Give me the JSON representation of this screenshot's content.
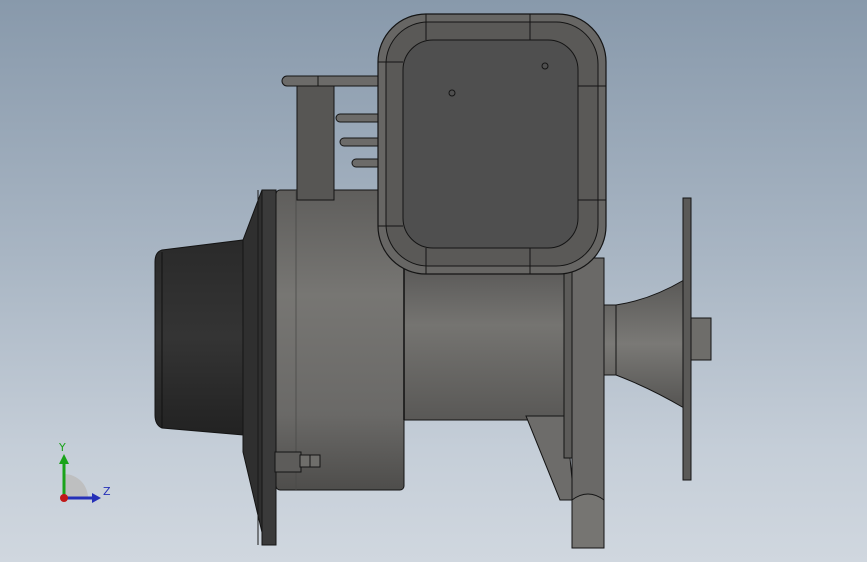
{
  "viewport": {
    "background_top": "#8899ab",
    "background_bottom": "#d0d7df"
  },
  "model": {
    "body_color": "#6d6c6a",
    "connector_color": "#4f4f4f",
    "flange_color": "#2e2e2e",
    "edge_color": "#141414"
  },
  "triad": {
    "y_label": "Y",
    "z_label": "Z",
    "y_color": "#1aa31a",
    "z_color": "#2530b8",
    "origin_color": "#c01818"
  }
}
